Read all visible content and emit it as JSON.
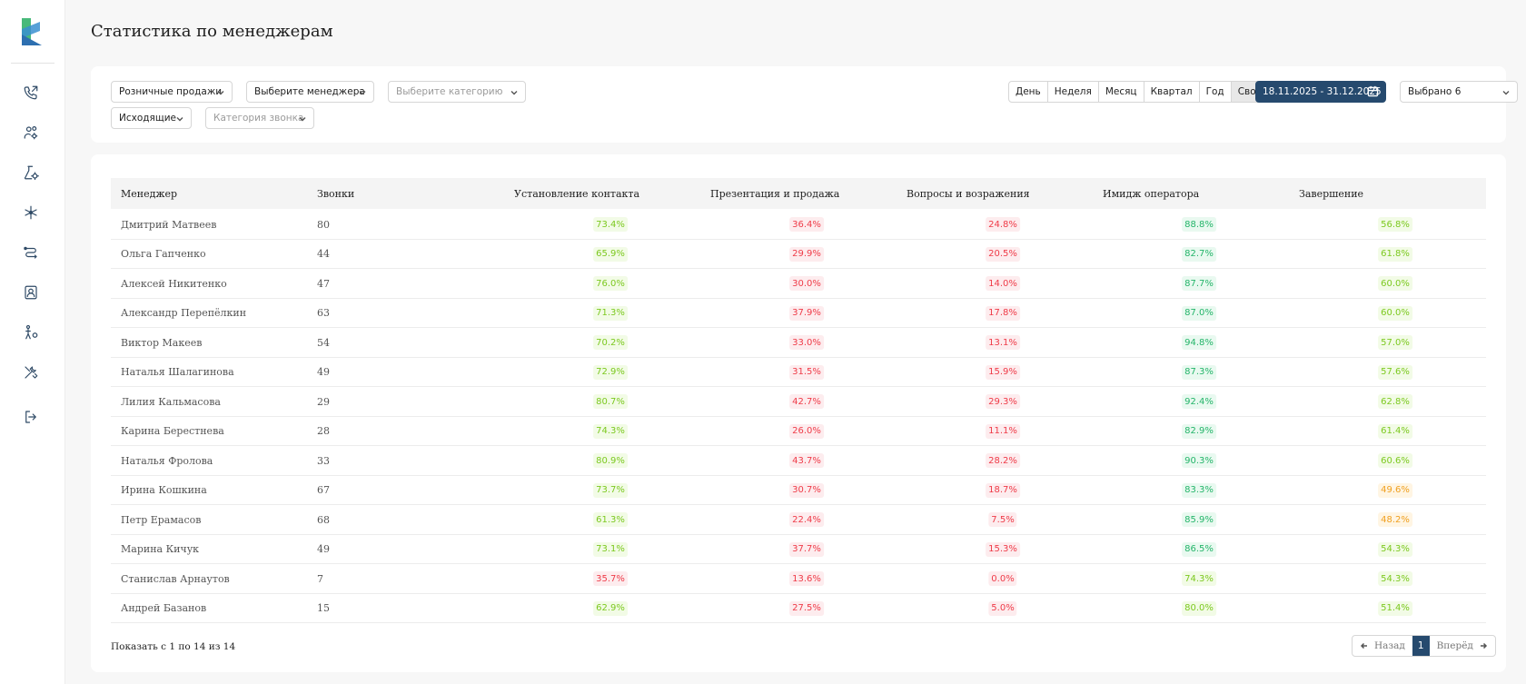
{
  "page": {
    "title": "Статистика по менеджерам"
  },
  "sidebar": {
    "icons": [
      "phone-outgoing-icon",
      "users-settings-icon",
      "flask-settings-icon",
      "sparkle-icon",
      "routes-icon",
      "contact-card-icon",
      "person-settings-icon",
      "tools-icon",
      "logout-icon"
    ]
  },
  "filters": {
    "sales_type": "Розничные продажи",
    "manager": "Выберите менеджера",
    "category": "Выберите категорию",
    "direction": "Исходящие",
    "call_category": "Категория звонка",
    "periods": [
      "День",
      "Неделя",
      "Месяц",
      "Квартал",
      "Год",
      "Свой"
    ],
    "active_period": "Свой",
    "date_range": "18.11.2025 - 31.12.2025",
    "selected": "Выбрано 6",
    "page_size": "20"
  },
  "table": {
    "headers": [
      "Менеджер",
      "Звонки",
      "Установление контакта",
      "Презентация и продажа",
      "Вопросы и возражения",
      "Имидж оператора",
      "Завершение"
    ],
    "rows": [
      {
        "name": "Дмитрий Матвеев",
        "calls": "80",
        "v": [
          "73.4%",
          "36.4%",
          "24.8%",
          "88.8%",
          "56.8%"
        ],
        "c": [
          "green",
          "red",
          "red",
          "green2",
          "green"
        ]
      },
      {
        "name": "Ольга Гапченко",
        "calls": "44",
        "v": [
          "65.9%",
          "29.9%",
          "20.5%",
          "82.7%",
          "61.8%"
        ],
        "c": [
          "green",
          "red",
          "red",
          "green2",
          "green"
        ]
      },
      {
        "name": "Алексей Никитенко",
        "calls": "47",
        "v": [
          "76.0%",
          "30.0%",
          "14.0%",
          "87.7%",
          "60.0%"
        ],
        "c": [
          "green",
          "red",
          "red",
          "green2",
          "green"
        ]
      },
      {
        "name": "Александр Перепёлкин",
        "calls": "63",
        "v": [
          "71.3%",
          "37.9%",
          "17.8%",
          "87.0%",
          "60.0%"
        ],
        "c": [
          "green",
          "red",
          "red",
          "green2",
          "green"
        ]
      },
      {
        "name": "Виктор Макеев",
        "calls": "54",
        "v": [
          "70.2%",
          "33.0%",
          "13.1%",
          "94.8%",
          "57.0%"
        ],
        "c": [
          "green",
          "red",
          "red",
          "green2",
          "green"
        ]
      },
      {
        "name": "Наталья Шалагинова",
        "calls": "49",
        "v": [
          "72.9%",
          "31.5%",
          "15.9%",
          "87.3%",
          "57.6%"
        ],
        "c": [
          "green",
          "red",
          "red",
          "green2",
          "green"
        ]
      },
      {
        "name": "Лилия Кальмасова",
        "calls": "29",
        "v": [
          "80.7%",
          "42.7%",
          "29.3%",
          "92.4%",
          "62.8%"
        ],
        "c": [
          "green",
          "red",
          "red",
          "green2",
          "green"
        ]
      },
      {
        "name": "Карина Берестнева",
        "calls": "28",
        "v": [
          "74.3%",
          "26.0%",
          "11.1%",
          "82.9%",
          "61.4%"
        ],
        "c": [
          "green",
          "red",
          "red",
          "green2",
          "green"
        ]
      },
      {
        "name": "Наталья Фролова",
        "calls": "33",
        "v": [
          "80.9%",
          "43.7%",
          "28.2%",
          "90.3%",
          "60.6%"
        ],
        "c": [
          "green",
          "red",
          "red",
          "green2",
          "green"
        ]
      },
      {
        "name": "Ирина Кошкина",
        "calls": "67",
        "v": [
          "73.7%",
          "30.7%",
          "18.7%",
          "83.3%",
          "49.6%"
        ],
        "c": [
          "green",
          "red",
          "red",
          "green2",
          "orange"
        ]
      },
      {
        "name": "Петр Ерамасов",
        "calls": "68",
        "v": [
          "61.3%",
          "22.4%",
          "7.5%",
          "85.9%",
          "48.2%"
        ],
        "c": [
          "green",
          "red",
          "red",
          "green2",
          "orange"
        ]
      },
      {
        "name": "Марина Кичук",
        "calls": "49",
        "v": [
          "73.1%",
          "37.7%",
          "15.3%",
          "86.5%",
          "54.3%"
        ],
        "c": [
          "green",
          "red",
          "red",
          "green2",
          "green"
        ]
      },
      {
        "name": "Станислав Арнаутов",
        "calls": "7",
        "v": [
          "35.7%",
          "13.6%",
          "0.0%",
          "74.3%",
          "54.3%"
        ],
        "c": [
          "red",
          "red",
          "red",
          "green",
          "green"
        ]
      },
      {
        "name": "Андрей Базанов",
        "calls": "15",
        "v": [
          "62.9%",
          "27.5%",
          "5.0%",
          "80.0%",
          "51.4%"
        ],
        "c": [
          "green",
          "red",
          "red",
          "green",
          "green"
        ]
      }
    ]
  },
  "footer": {
    "summary": "Показать с 1 по 14 из 14",
    "prev_label": "Назад",
    "next_label": "Вперёд",
    "current_page": "1"
  },
  "colors": {
    "accent": "#264a6e",
    "good": "#7cc91f",
    "great": "#25b56a",
    "bad": "#ef3b48",
    "warn": "#f0a020"
  }
}
